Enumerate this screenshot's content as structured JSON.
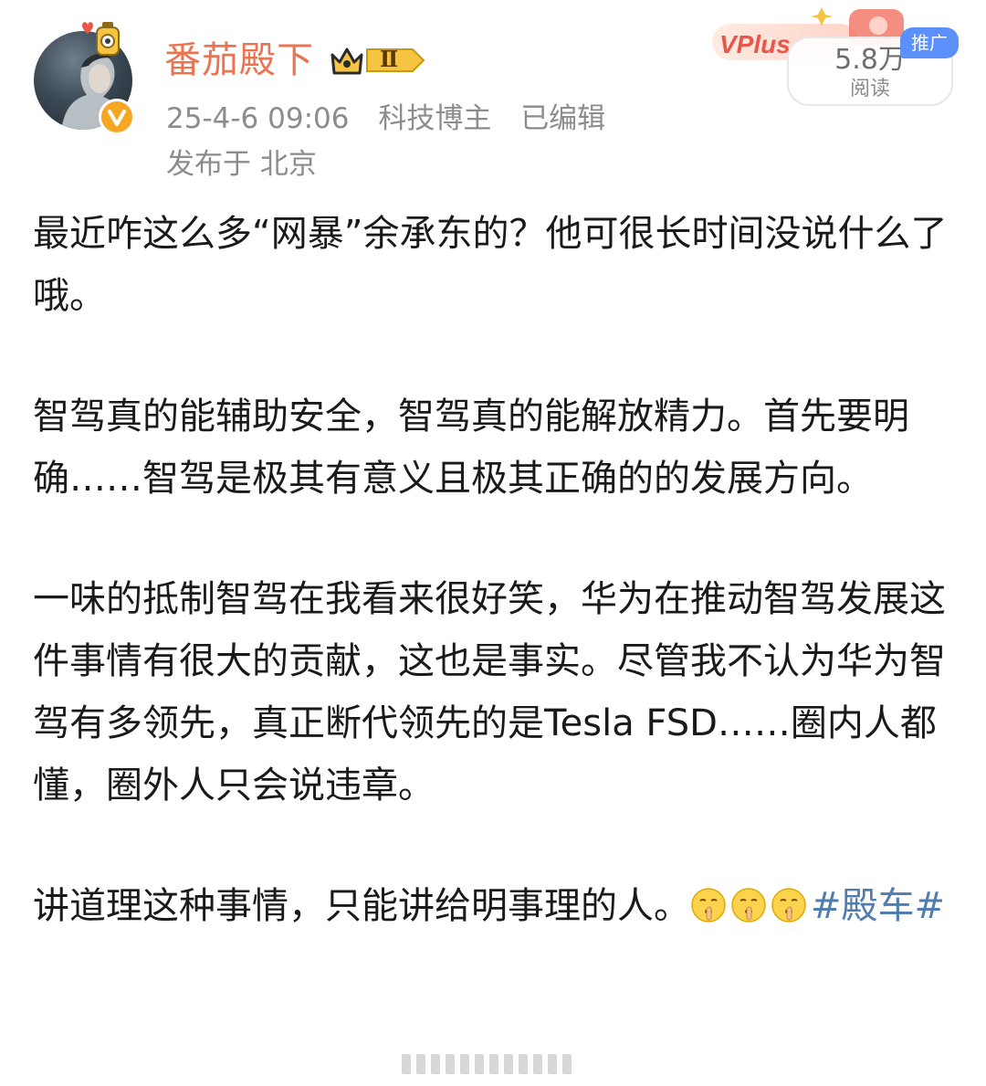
{
  "post": {
    "author": {
      "name": "番茄殿下",
      "avatar_icon": "avatar-photo",
      "verified_icon": "verified-v-icon",
      "rank_badge_text": "Ⅱ"
    },
    "meta": {
      "time": "25-4-6 09:06",
      "category": "科技博主",
      "edited": "已编辑",
      "location": "发布于 北京"
    },
    "stats": {
      "read_count": "5.8万",
      "read_label": "阅读",
      "promo_tag": "推广",
      "vplus_text": "VPlus"
    },
    "paragraphs": [
      "最近咋这么多“网暴”余承东的？他可很长时间没说什么了哦。",
      "智驾真的能辅助安全，智驾真的能解放精力。首先要明确……智驾是极其有意义且极其正确的的发展方向。",
      "一味的抵制智驾在我看来很好笑，华为在推动智驾发展这件事情有很大的贡献，这也是事实。尽管我不认为华为智驾有多领先，真正断代领先的是Tesla FSD……圈内人都懂，圈外人只会说违章。"
    ],
    "last_paragraph": {
      "text": "讲道理这种事情，只能讲给明事理的人。",
      "emoji_icons": [
        "shush-emoji-icon",
        "shush-emoji-icon",
        "shush-emoji-icon"
      ],
      "hashtag": "#殿车#"
    }
  },
  "colors": {
    "username": "#eb7350",
    "meta": "#8c8c8c",
    "hashtag": "#507daf",
    "promo": "#5b8ff9",
    "vplus": "#e8574a"
  }
}
